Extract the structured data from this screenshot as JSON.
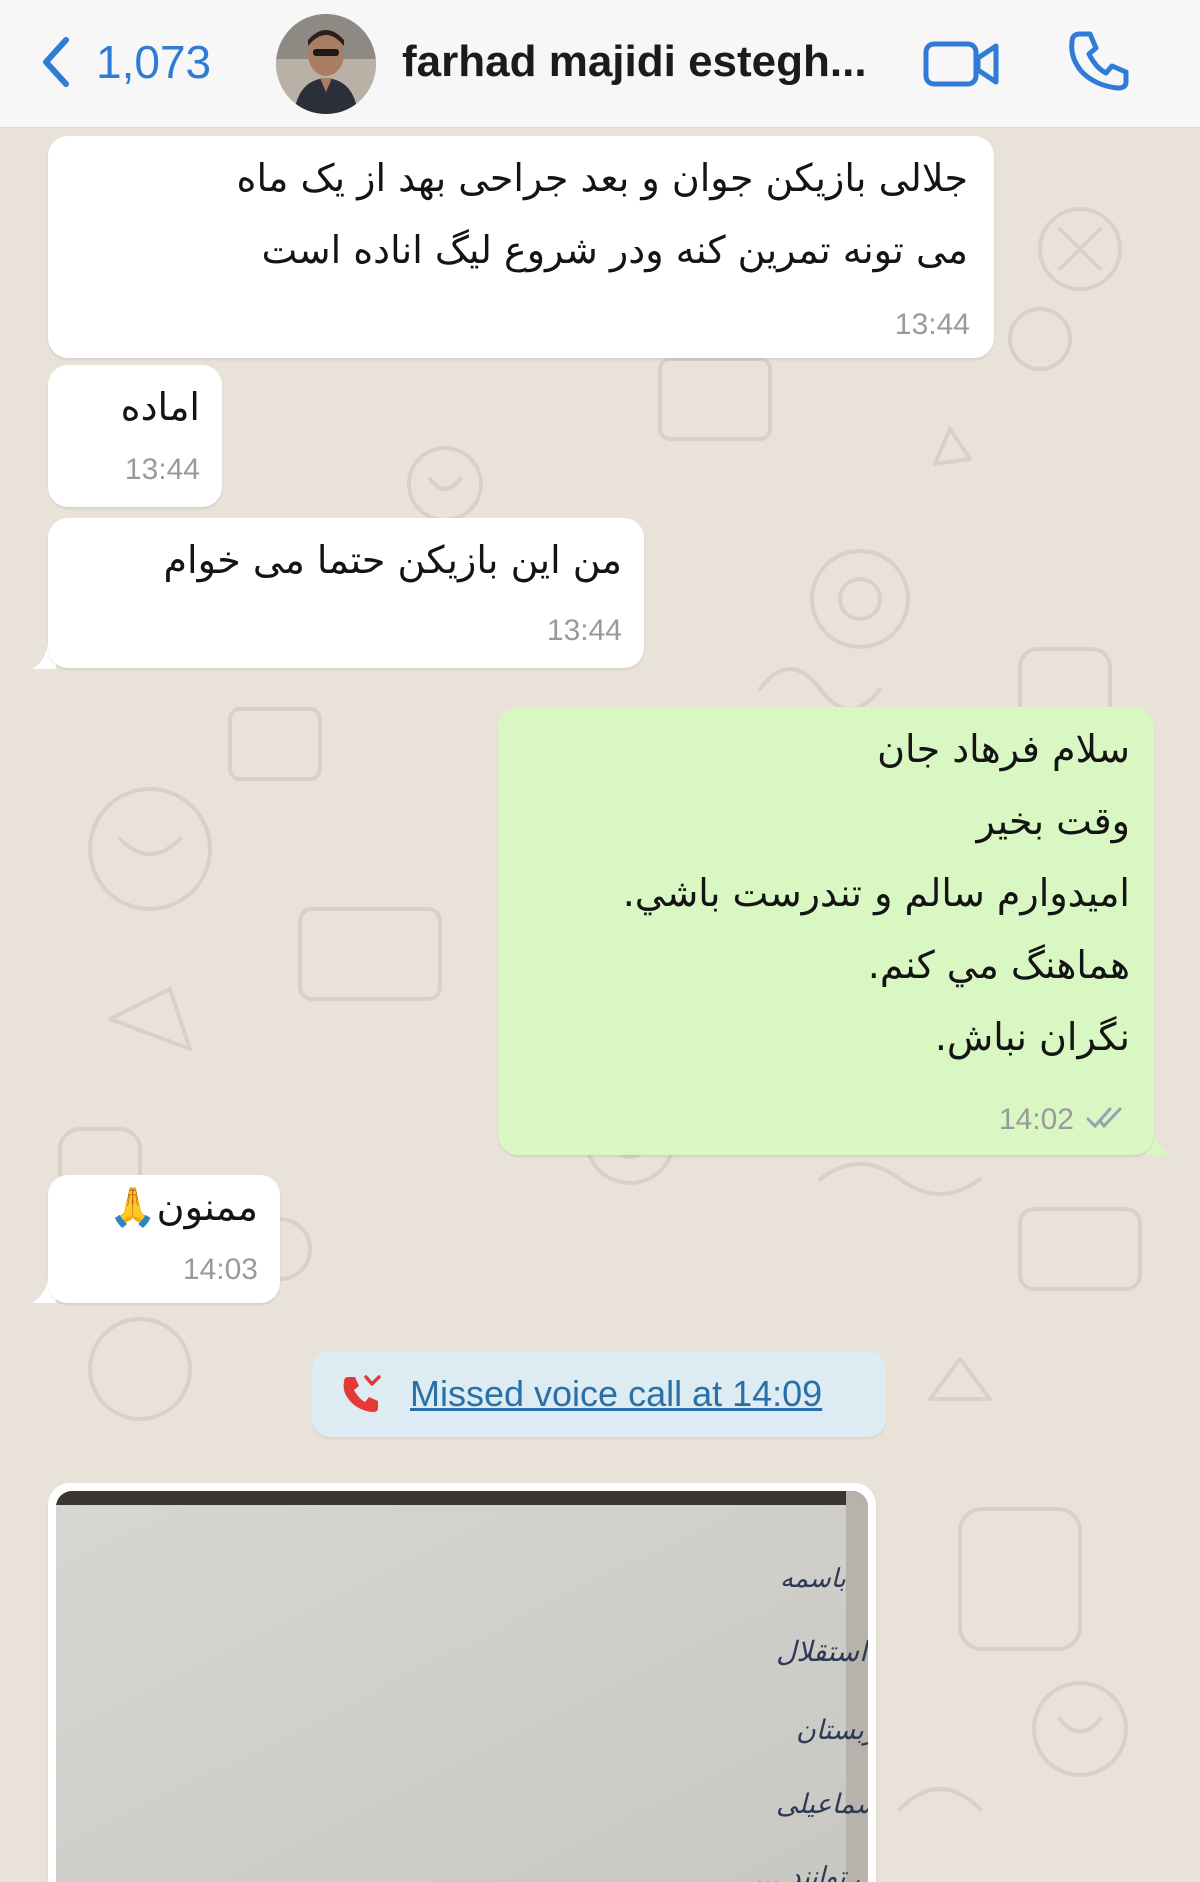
{
  "header": {
    "back_count": "1,073",
    "contact_name": "farhad majidi estegh...",
    "avatar_icon": "contact-avatar",
    "video_icon": "video-camera-icon",
    "call_icon": "phone-icon",
    "accent": "#2f7bd6"
  },
  "messages": [
    {
      "direction": "incoming",
      "text": "جلالی بازیکن جوان و بعد جراحی بهد از یک ماه\nمی تونه تمرین کنه ودر شروع لیگ اناده است",
      "time": "13:44"
    },
    {
      "direction": "incoming",
      "text": "اماده",
      "time": "13:44"
    },
    {
      "direction": "incoming",
      "text": "من این بازیکن حتما می خوام",
      "time": "13:44"
    },
    {
      "direction": "outgoing",
      "text": "سلام فرهاد جان\nوقت بخير\nاميدوارم سالم و تندرست باشي.\nهماهنگ مي كنم.\nنگران نباش.",
      "time": "14:02",
      "status": "read"
    },
    {
      "direction": "incoming",
      "text": "ممنون🙏",
      "time": "14:03"
    }
  ],
  "system": {
    "missed_call": "Missed voice call at 14:09",
    "missed_call_icon": "missed-call-icon"
  },
  "attachment": {
    "type": "photo",
    "content": "handwritten letter",
    "handwriting": {
      "line_1": "باسمه",
      "line_2": "خدمت آقای مکیان رئیس هیات مدیره استقلال",
      "line_3": "با توجه به نزدیکی بازی مرحله استقلال با تیم الهلال عربستان",
      "line_4": "از نظر فنی آقای ارسلان مطهری و حمیدرضا اسماعیلی",
      "line_5": "حدود یک ماه نمی توانند ..."
    }
  },
  "colors": {
    "incoming_bubble": "#ffffff",
    "outgoing_bubble": "#d9f7c3",
    "wallpaper": "#e8e2d9",
    "read_ticks": "#8fa4b5",
    "missed_call_red": "#e53935"
  }
}
